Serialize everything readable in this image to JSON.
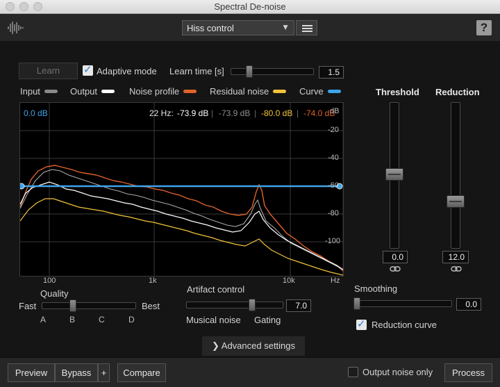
{
  "window": {
    "title": "Spectral De-noise"
  },
  "header": {
    "preset": "Hiss control",
    "help_label": "?"
  },
  "learn": {
    "learn_label": "Learn",
    "adaptive_mode_label": "Adaptive mode",
    "adaptive_mode_checked": true,
    "learn_time_label": "Learn time [s]",
    "learn_time_value": "1.5"
  },
  "legend": [
    {
      "label": "Input",
      "color": "#8a8a8a"
    },
    {
      "label": "Output",
      "color": "#ffffff"
    },
    {
      "label": "Noise profile",
      "color": "#e0632a"
    },
    {
      "label": "Residual noise",
      "color": "#f2c43a"
    },
    {
      "label": "Curve",
      "color": "#3ea3e8"
    }
  ],
  "spectrum": {
    "curve_level": "0.0 dB",
    "freq_readout": "22 Hz:",
    "readout_input": "-73.9 dB",
    "readout_output": "-73.9 dB",
    "readout_residual": "-80.0 dB",
    "readout_noise": "-74.0 dB",
    "db_unit": "dB",
    "db_ticks": [
      "-20",
      "-40",
      "-60",
      "-80",
      "-100"
    ],
    "freq_ticks": [
      "100",
      "1k",
      "10k",
      "Hz"
    ]
  },
  "threshold": {
    "label": "Threshold",
    "value": "0.0"
  },
  "reduction": {
    "label": "Reduction",
    "value": "12.0"
  },
  "quality": {
    "label": "Quality",
    "fast_label": "Fast",
    "best_label": "Best",
    "options": [
      "A",
      "B",
      "C",
      "D"
    ]
  },
  "artifact": {
    "label": "Artifact control",
    "value": "7.0",
    "left_label": "Musical noise",
    "right_label": "Gating"
  },
  "smoothing": {
    "label": "Smoothing",
    "value": "0.0",
    "reduction_curve_label": "Reduction curve",
    "reduction_curve_checked": true
  },
  "advanced_label": "Advanced settings",
  "footer": {
    "preview_label": "Preview",
    "bypass_label": "Bypass",
    "plus_label": "+",
    "compare_label": "Compare",
    "output_noise_label": "Output noise only",
    "output_noise_checked": false,
    "process_label": "Process"
  }
}
